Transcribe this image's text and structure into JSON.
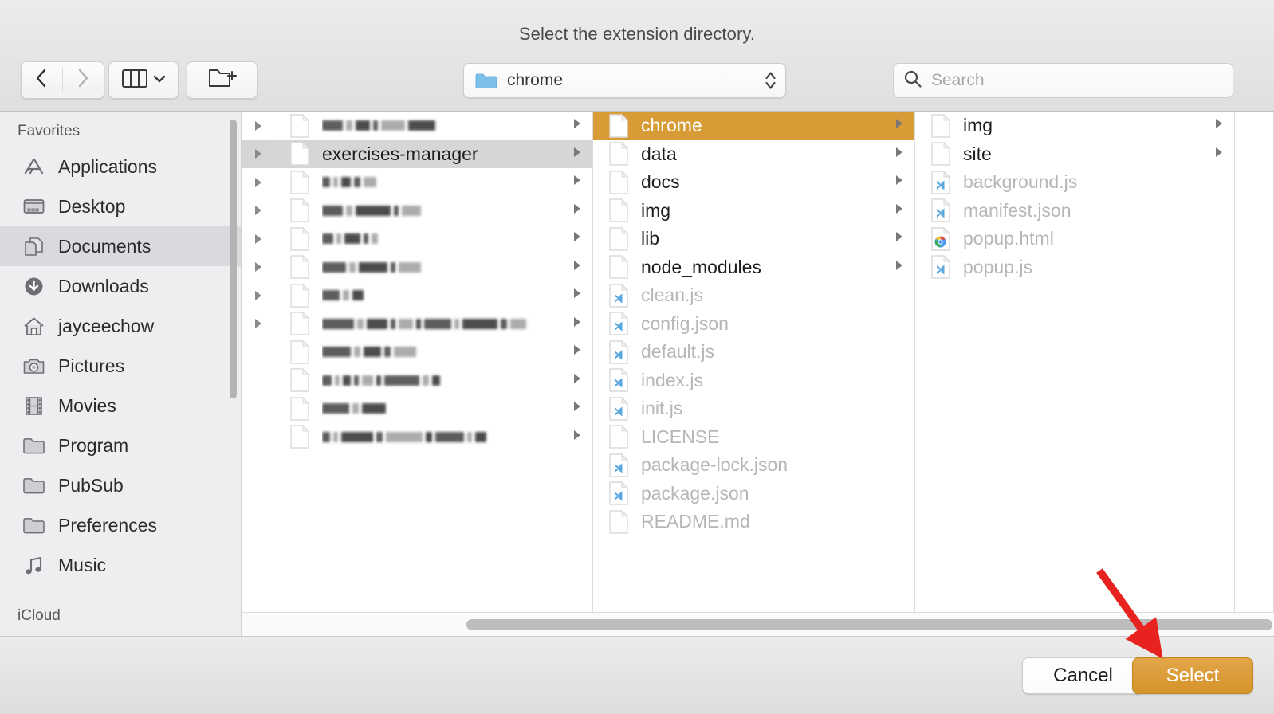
{
  "dialog": {
    "title": "Select the extension directory."
  },
  "toolbar": {
    "back": "back-arrow",
    "forward": "forward-arrow",
    "view_mode": "column-view",
    "new_folder": "new-folder",
    "path": {
      "label": "chrome",
      "icon": "folder-icon"
    },
    "search": {
      "placeholder": "Search",
      "value": ""
    }
  },
  "sidebar": {
    "sections": [
      {
        "header": "Favorites",
        "items": [
          {
            "label": "Applications",
            "icon": "applications-icon",
            "selected": false
          },
          {
            "label": "Desktop",
            "icon": "desktop-icon",
            "selected": false
          },
          {
            "label": "Documents",
            "icon": "documents-icon",
            "selected": true
          },
          {
            "label": "Downloads",
            "icon": "downloads-icon",
            "selected": false
          },
          {
            "label": "jayceechow",
            "icon": "home-icon",
            "selected": false
          },
          {
            "label": "Pictures",
            "icon": "pictures-icon",
            "selected": false
          },
          {
            "label": "Movies",
            "icon": "movies-icon",
            "selected": false
          },
          {
            "label": "Program",
            "icon": "folder-icon",
            "selected": false
          },
          {
            "label": "PubSub",
            "icon": "folder-icon",
            "selected": false
          },
          {
            "label": "Preferences",
            "icon": "folder-icon",
            "selected": false
          },
          {
            "label": "Music",
            "icon": "music-icon",
            "selected": false
          }
        ]
      },
      {
        "header": "iCloud",
        "items": []
      }
    ]
  },
  "columns": [
    {
      "name": "column-1",
      "rows": [
        {
          "label": "",
          "redacted": true,
          "kind": "folder",
          "selected": false,
          "has_children": true,
          "redact_pattern": [
            26,
            8,
            18,
            6,
            30,
            34
          ]
        },
        {
          "label": "exercises-manager",
          "redacted": false,
          "kind": "folder",
          "selected": true,
          "has_children": true
        },
        {
          "label": "",
          "redacted": true,
          "kind": "folder",
          "selected": false,
          "has_children": true,
          "redact_pattern": [
            10,
            6,
            12,
            8,
            16
          ]
        },
        {
          "label": "",
          "redacted": true,
          "kind": "folder",
          "selected": false,
          "has_children": true,
          "redact_pattern": [
            26,
            8,
            44,
            6,
            24
          ]
        },
        {
          "label": "",
          "redacted": true,
          "kind": "folder",
          "selected": false,
          "has_children": true,
          "redact_pattern": [
            14,
            6,
            20,
            6,
            8
          ]
        },
        {
          "label": "",
          "redacted": true,
          "kind": "folder",
          "selected": false,
          "has_children": true,
          "redact_pattern": [
            30,
            8,
            36,
            6,
            28
          ]
        },
        {
          "label": "",
          "redacted": true,
          "kind": "folder",
          "selected": false,
          "has_children": true,
          "redact_pattern": [
            22,
            8,
            14
          ]
        },
        {
          "label": "",
          "redacted": true,
          "kind": "folder",
          "selected": false,
          "has_children": true,
          "redact_pattern": [
            40,
            8,
            26,
            6,
            18,
            6,
            34,
            6,
            44,
            8,
            20
          ]
        },
        {
          "label": "",
          "redacted": true,
          "kind": "folder",
          "selected": false,
          "has_children": true,
          "redact_pattern": [
            36,
            8,
            22,
            8,
            28
          ]
        },
        {
          "label": "",
          "redacted": true,
          "kind": "folder",
          "selected": false,
          "has_children": true,
          "redact_pattern": [
            12,
            6,
            10,
            6,
            14,
            6,
            44,
            8,
            10
          ]
        },
        {
          "label": "",
          "redacted": true,
          "kind": "folder",
          "selected": false,
          "has_children": true,
          "redact_pattern": [
            34,
            8,
            30
          ]
        },
        {
          "label": "",
          "redacted": true,
          "kind": "folder",
          "selected": false,
          "has_children": true,
          "redact_pattern": [
            10,
            6,
            40,
            8,
            46,
            8,
            36,
            6,
            14
          ]
        }
      ]
    },
    {
      "name": "column-2",
      "rows": [
        {
          "label": "chrome",
          "kind": "folder",
          "selected": true,
          "has_children": true,
          "disabled": false
        },
        {
          "label": "data",
          "kind": "folder",
          "selected": false,
          "has_children": true,
          "disabled": false
        },
        {
          "label": "docs",
          "kind": "folder",
          "selected": false,
          "has_children": true,
          "disabled": false
        },
        {
          "label": "img",
          "kind": "folder",
          "selected": false,
          "has_children": true,
          "disabled": false
        },
        {
          "label": "lib",
          "kind": "folder",
          "selected": false,
          "has_children": true,
          "disabled": false
        },
        {
          "label": "node_modules",
          "kind": "folder",
          "selected": false,
          "has_children": true,
          "disabled": false
        },
        {
          "label": "clean.js",
          "kind": "vscode-file",
          "selected": false,
          "has_children": false,
          "disabled": true
        },
        {
          "label": "config.json",
          "kind": "vscode-file",
          "selected": false,
          "has_children": false,
          "disabled": true
        },
        {
          "label": "default.js",
          "kind": "vscode-file",
          "selected": false,
          "has_children": false,
          "disabled": true
        },
        {
          "label": "index.js",
          "kind": "vscode-file",
          "selected": false,
          "has_children": false,
          "disabled": true
        },
        {
          "label": "init.js",
          "kind": "vscode-file",
          "selected": false,
          "has_children": false,
          "disabled": true
        },
        {
          "label": "LICENSE",
          "kind": "plain-file",
          "selected": false,
          "has_children": false,
          "disabled": true
        },
        {
          "label": "package-lock.json",
          "kind": "vscode-file",
          "selected": false,
          "has_children": false,
          "disabled": true
        },
        {
          "label": "package.json",
          "kind": "vscode-file",
          "selected": false,
          "has_children": false,
          "disabled": true
        },
        {
          "label": "README.md",
          "kind": "plain-file",
          "selected": false,
          "has_children": false,
          "disabled": true
        }
      ]
    },
    {
      "name": "column-3",
      "rows": [
        {
          "label": "img",
          "kind": "folder",
          "selected": false,
          "has_children": true,
          "disabled": false
        },
        {
          "label": "site",
          "kind": "folder",
          "selected": false,
          "has_children": true,
          "disabled": false
        },
        {
          "label": "background.js",
          "kind": "vscode-file",
          "selected": false,
          "has_children": false,
          "disabled": true
        },
        {
          "label": "manifest.json",
          "kind": "vscode-file",
          "selected": false,
          "has_children": false,
          "disabled": true
        },
        {
          "label": "popup.html",
          "kind": "chrome-file",
          "selected": false,
          "has_children": false,
          "disabled": true
        },
        {
          "label": "popup.js",
          "kind": "vscode-file",
          "selected": false,
          "has_children": false,
          "disabled": true
        }
      ]
    }
  ],
  "footer": {
    "cancel_label": "Cancel",
    "select_label": "Select"
  },
  "annotation": {
    "arrow": "red-arrow-pointing-to-select-button",
    "color": "#e8231f"
  },
  "colors": {
    "selection_orange": "#d89c36",
    "selection_grey": "#d6d6d6",
    "folder_blue": "#7cc0ea",
    "disabled_text": "#b6b6b6",
    "annotation_red": "#e8231f"
  }
}
